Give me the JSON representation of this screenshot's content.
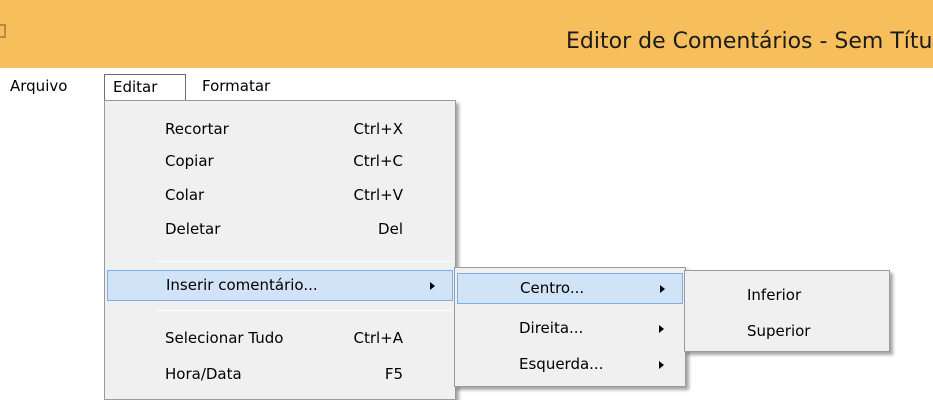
{
  "window": {
    "title": "Editor de Comentários - Sem Títu"
  },
  "menubar": {
    "items": [
      {
        "label": "Arquivo"
      },
      {
        "label": "Editar"
      },
      {
        "label": "Formatar"
      }
    ],
    "active": "Editar"
  },
  "edit_menu": {
    "items": [
      {
        "label": "Recortar",
        "shortcut": "Ctrl+X"
      },
      {
        "label": "Copiar",
        "shortcut": "Ctrl+C"
      },
      {
        "label": "Colar",
        "shortcut": "Ctrl+V"
      },
      {
        "label": "Deletar",
        "shortcut": "Del"
      },
      {
        "label": "Inserir comentário...",
        "submenu": true,
        "highlighted": true
      },
      {
        "label": "Selecionar Tudo",
        "shortcut": "Ctrl+A"
      },
      {
        "label": "Hora/Data",
        "shortcut": "F5"
      }
    ]
  },
  "insert_submenu": {
    "items": [
      {
        "label": "Centro...",
        "submenu": true,
        "highlighted": true
      },
      {
        "label": "Direita...",
        "submenu": true
      },
      {
        "label": "Esquerda...",
        "submenu": true
      }
    ]
  },
  "center_submenu": {
    "items": [
      {
        "label": "Inferior"
      },
      {
        "label": "Superior"
      }
    ]
  },
  "colors": {
    "titlebar": "#f6bf5c",
    "menu_background": "#f0f0f0",
    "highlight_fill": "#d1e3f7",
    "highlight_border": "#7daee6"
  },
  "icons": {
    "submenu_arrow": "chevron-right-icon",
    "window_icon": "app-icon"
  }
}
